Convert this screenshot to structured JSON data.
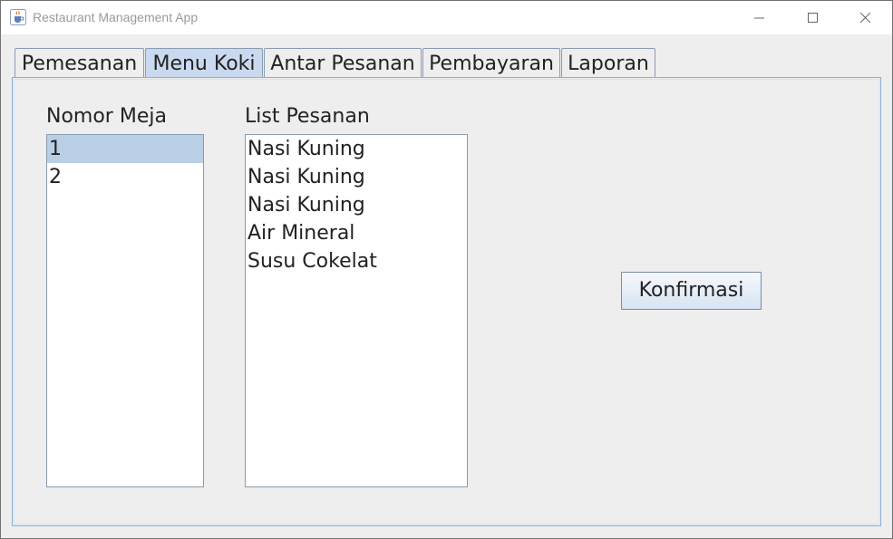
{
  "window": {
    "title": "Restaurant Management App",
    "icon": "java-cup-icon"
  },
  "title_bar_controls": [
    "minimize-icon",
    "maximize-icon",
    "close-icon"
  ],
  "tabs": [
    {
      "label": "Pemesanan",
      "selected": false
    },
    {
      "label": "Menu Koki",
      "selected": true
    },
    {
      "label": "Antar Pesanan",
      "selected": false
    },
    {
      "label": "Pembayaran",
      "selected": false
    },
    {
      "label": "Laporan",
      "selected": false
    }
  ],
  "menu_koki": {
    "nomor_meja_label": "Nomor Meja",
    "nomor_meja_items": [
      "1",
      "2"
    ],
    "selected_meja": "1",
    "list_pesanan_label": "List Pesanan",
    "list_pesanan_items": [
      "Nasi Kuning",
      "Nasi Kuning",
      "Nasi Kuning",
      "Air Mineral",
      "Susu Cokelat"
    ],
    "confirm_label": "Konfirmasi"
  },
  "colors": {
    "selected_tab": "#c9d9ef",
    "selected_list_item": "#b8cfe5",
    "panel_border": "#8aaed4"
  }
}
